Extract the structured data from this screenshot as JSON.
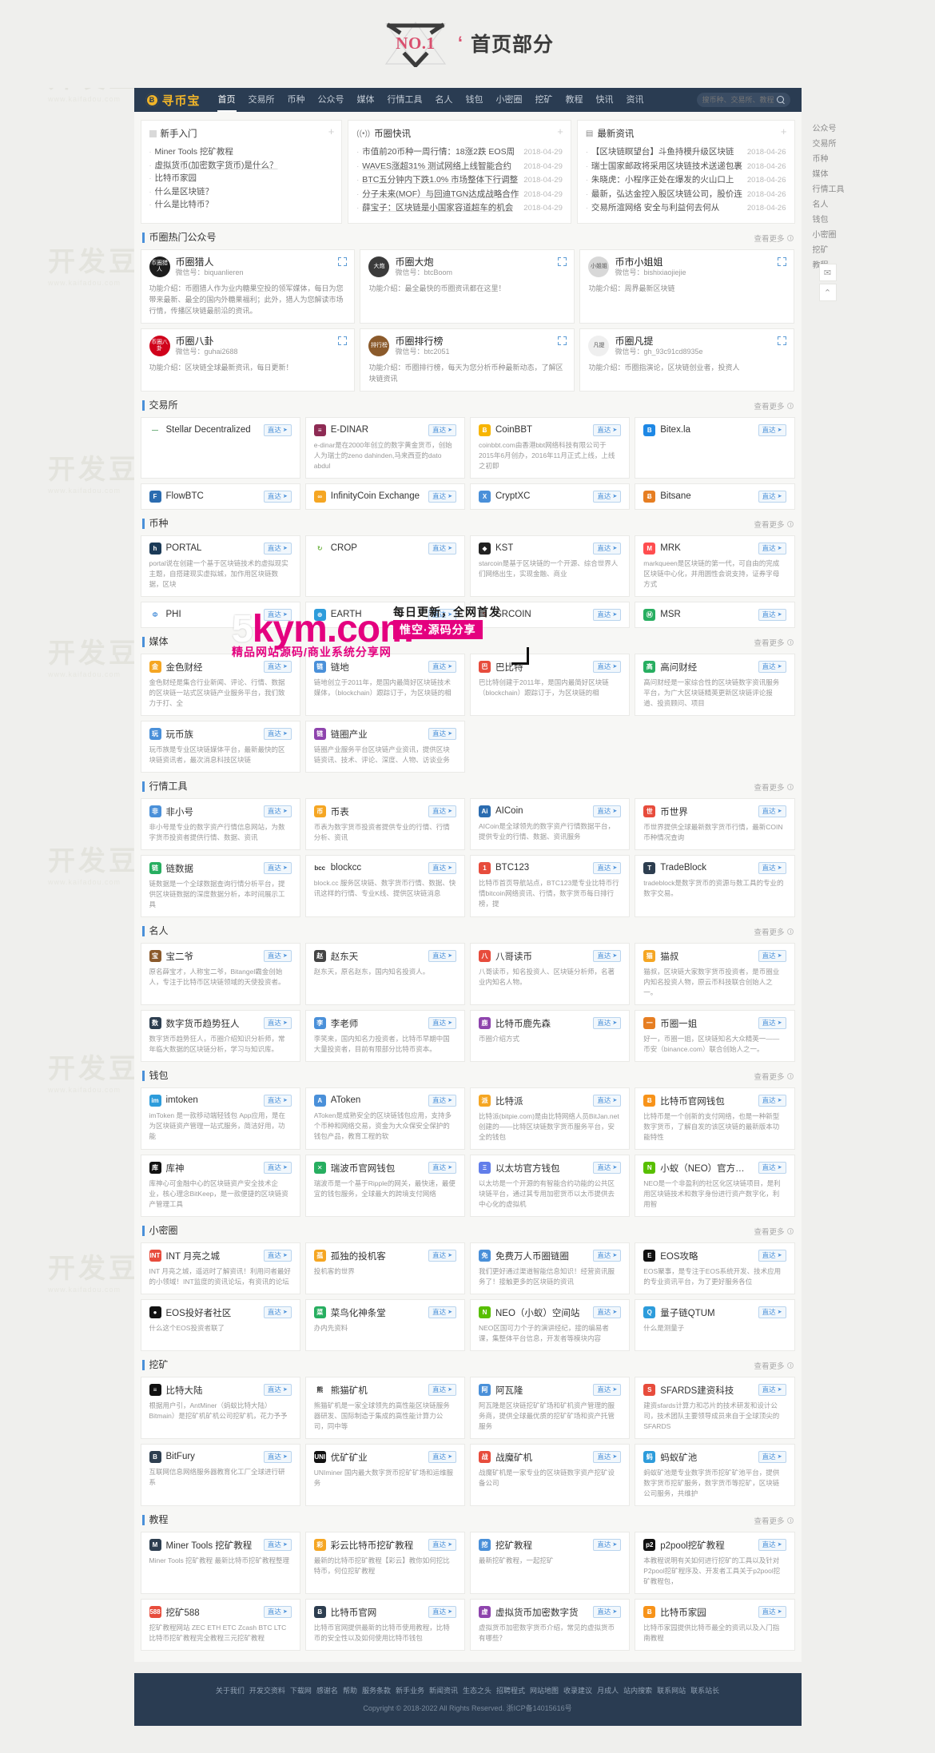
{
  "banner": {
    "badge": "NO.1",
    "quote": "‘",
    "title": "首页部分"
  },
  "nav": {
    "logo_letter": "Ƀ",
    "logo_text": "寻币宝",
    "items": [
      {
        "label": "首页",
        "active": true
      },
      {
        "label": "交易所",
        "active": false
      },
      {
        "label": "币种",
        "active": false
      },
      {
        "label": "公众号",
        "active": false
      },
      {
        "label": "媒体",
        "active": false
      },
      {
        "label": "行情工具",
        "active": false
      },
      {
        "label": "名人",
        "active": false
      },
      {
        "label": "钱包",
        "active": false
      },
      {
        "label": "小密圈",
        "active": false
      },
      {
        "label": "挖矿",
        "active": false
      },
      {
        "label": "教程",
        "active": false
      },
      {
        "label": "快讯",
        "active": false
      },
      {
        "label": "资讯",
        "active": false
      }
    ],
    "search_placeholder": "搜币种、交易所、教程",
    "search_value": ""
  },
  "panels": [
    {
      "icon": "square-icon",
      "title": "新手入门",
      "items": [
        {
          "text": "Miner Tools 挖矿教程",
          "date": "",
          "underline": false
        },
        {
          "text": "虚拟货币(加密数字货币)是什么？",
          "date": "",
          "underline": true
        },
        {
          "text": "比特币家园",
          "date": "",
          "underline": false
        },
        {
          "text": "什么是区块链？",
          "date": "",
          "underline": false
        },
        {
          "text": "什么是比特币？",
          "date": "",
          "underline": false
        }
      ]
    },
    {
      "icon": "broadcast-icon",
      "title": "币圈快讯",
      "items": [
        {
          "text": "市值前20币种一周行情：18涨2跌 EOS周",
          "date": "2018-04-29",
          "underline": false
        },
        {
          "text": "WAVES涨超31% 测试网络上线智能合约",
          "date": "2018-04-29",
          "underline": true
        },
        {
          "text": "BTC五分钟内下跌1.0% 市场整体下行调整",
          "date": "2018-04-29",
          "underline": true
        },
        {
          "text": "分子未来(MOF）与回迪TGN达成战略合作",
          "date": "2018-04-29",
          "underline": true
        },
        {
          "text": "薛宝子：区块链是小国家容道超车的机会",
          "date": "2018-04-29",
          "underline": true
        }
      ]
    },
    {
      "icon": "news-icon",
      "title": "最新资讯",
      "items": [
        {
          "text": "【区块链瞑望台】斗鱼持模升级区块链",
          "date": "2018-04-26",
          "underline": false
        },
        {
          "text": "瑞士国家邮政将采用区块链技术送递包裹",
          "date": "2018-04-26",
          "underline": false
        },
        {
          "text": "朱晓虎：小程序正处在爆发的火山口上",
          "date": "2018-04-26",
          "underline": false
        },
        {
          "text": "最新，弘达金控入股区块链公司，股价连",
          "date": "2018-04-26",
          "underline": false
        },
        {
          "text": "交易所渲网络 安全与利益何去何从",
          "date": "2018-04-26",
          "underline": false
        }
      ]
    }
  ],
  "sections": [
    {
      "id": "gongzhonghao",
      "title": "币圈热门公众号",
      "more": "查看更多",
      "layout": "accounts",
      "cards": [
        {
          "name": "币圈猎人",
          "wx": "微信号：biquanlieren",
          "avatar_text": "币圈猎人",
          "avatar_color": "#1d1d1d",
          "desc": "功能介绍：币圈猎人作为业内糖果空投的领军媒体，每日为您带来最新、最全的国内外糖果福利；此外，猎人为您解读市场行情，传播区块链最前沿的资讯。"
        },
        {
          "name": "币圈大炮",
          "wx": "微信号：btcBoom",
          "avatar_text": "大炮",
          "avatar_color": "#3b3b3b",
          "desc": "功能介绍：最全最快的币圈资讯都在这里！"
        },
        {
          "name": "币市小姐姐",
          "wx": "微信号：bishixiaojiejie",
          "avatar_text": "小姐姐",
          "avatar_color": "#d8d8d8",
          "desc": "功能介绍：周界最新区块链"
        },
        {
          "name": "币圈八卦",
          "wx": "微信号：guhai2688",
          "avatar_text": "币圈八卦",
          "avatar_color": "#d0021b",
          "desc": "功能介绍：区块链全球最新资讯，每日更新！"
        },
        {
          "name": "币圈排行榜",
          "wx": "微信号：btc2051",
          "avatar_text": "排行榜",
          "avatar_color": "#8b5a2b",
          "desc": "功能介绍：币圈排行榜，每天为您分析币种最新动态，了解区块链资讯"
        },
        {
          "name": "币圈凡提",
          "wx": "微信号：gh_93c91cd8935e",
          "avatar_text": "凡提",
          "avatar_color": "#efefef",
          "desc": "功能介绍：币圈指演论，区块链创业者，投资人"
        }
      ]
    },
    {
      "id": "jiaoyisuo",
      "title": "交易所",
      "more": "查看更多",
      "layout": "links4",
      "badge_label": "直达",
      "cards": [
        {
          "name": "Stellar Decentralized",
          "ico": "—",
          "color": "#ffffff",
          "textcolor": "#5aa469",
          "desc": ""
        },
        {
          "name": "E-DINAR",
          "ico": "≡",
          "color": "#8e2b54",
          "desc": "e-dinar是在2000年创立的数字黄金货币，创始人为瑞士的zeno dahinden,马来西亚的dato abdul"
        },
        {
          "name": "CoinBBT",
          "ico": "Ƀ",
          "color": "#f7b500",
          "desc": "coinbbt.com由香港bbt网络科技有限公司于2015年6月创办，2016年11月正式上线，上线之初即"
        },
        {
          "name": "Bitex.la",
          "ico": "B",
          "color": "#1e88e5",
          "desc": ""
        },
        {
          "name": "FlowBTC",
          "ico": "F",
          "color": "#2b6cb0",
          "desc": ""
        },
        {
          "name": "InfinityCoin Exchange",
          "ico": "∞",
          "color": "#f5a623",
          "desc": ""
        },
        {
          "name": "CryptXC",
          "ico": "X",
          "color": "#4a90d9",
          "desc": ""
        },
        {
          "name": "Bitsane",
          "ico": "Ƀ",
          "color": "#e67e22",
          "desc": ""
        }
      ]
    },
    {
      "id": "bizhong",
      "title": "币种",
      "more": "查看更多",
      "layout": "links4",
      "badge_label": "直达",
      "cards": [
        {
          "name": "PORTAL",
          "ico": "h",
          "color": "#1b3a57",
          "desc": "portal说在创建一个基于区块链技术的虚拟现实主题，自搭建现实虚拟城，加作用区块链数据，区块"
        },
        {
          "name": "CROP",
          "ico": "↻",
          "color": "#ffffff",
          "textcolor": "#6cb33f",
          "desc": ""
        },
        {
          "name": "KST",
          "ico": "◆",
          "color": "#222222",
          "desc": "starcoin是基于区块链的一个开源、综合世界人们网络出生，实现金融、商业"
        },
        {
          "name": "MRK",
          "ico": "M",
          "color": "#ff4d4f",
          "desc": "markqueen是区块链的第一代，可自由的完成区块链中心化，并用圆性会说支持，证券字母方式"
        },
        {
          "name": "PHI",
          "ico": "Φ",
          "color": "#ffffff",
          "textcolor": "#4a90d9",
          "desc": ""
        },
        {
          "name": "EARTH",
          "ico": "⊕",
          "color": "#2d9cdb",
          "desc": ""
        },
        {
          "name": "SRCOIN",
          "ico": "S",
          "color": "#ffffff",
          "textcolor": "#e74c3c",
          "desc": ""
        },
        {
          "name": "MSR",
          "ico": "Ⓜ",
          "color": "#27ae60",
          "desc": ""
        }
      ]
    },
    {
      "id": "meiti",
      "title": "媒体",
      "more": "查看更多",
      "layout": "links4",
      "badge_label": "直达",
      "cards": [
        {
          "name": "金色财经",
          "ico": "金",
          "color": "#f5a623",
          "desc": "金色财经是集合行业新闻、评论、行情、数据的区块链一站式区块链产业服务平台，我们致力于打、全"
        },
        {
          "name": "链地",
          "ico": "链",
          "color": "#4a90d9",
          "desc": "链地创立于2011年，是国内最简好区块链技术媒体，（blockchain）跟踪订于，为区块链的相"
        },
        {
          "name": "巴比特",
          "ico": "巴",
          "color": "#e74c3c",
          "desc": "巴比特创建于2011年，是国内最简好区块链（blockchain）跟踪订于，为区块链的相"
        },
        {
          "name": "高问财经",
          "ico": "高",
          "color": "#27ae60",
          "desc": "高问财经是一家综合性的区块链数字资讯服务平台，为广大区块链精英更新区块链评论报道、投资顾问、项目"
        },
        {
          "name": "玩币族",
          "ico": "玩",
          "color": "#4a90d9",
          "desc": "玩币族是专业区块链媒体平台，最新最快的区块链资讯者，最次消息科技区块链"
        },
        {
          "name": "链圈产业",
          "ico": "链",
          "color": "#8e44ad",
          "desc": "链圈产业服务平台区块链产业资讯，提供区块链资讯、技术、评论、深度、人物、访谈业务"
        }
      ]
    },
    {
      "id": "hangqing",
      "title": "行情工具",
      "more": "查看更多",
      "layout": "links4",
      "badge_label": "直达",
      "cards": [
        {
          "name": "非小号",
          "ico": "非",
          "color": "#4a90d9",
          "desc": "非小号是专业的数字资产行情信息网站，为数字货币投资者提供行情、数据、资讯"
        },
        {
          "name": "币表",
          "ico": "币",
          "color": "#f5a623",
          "desc": "币表为数字货币投资者提供专业的行情、行情分析、资讯"
        },
        {
          "name": "AICoin",
          "ico": "Ai",
          "color": "#2b6cb0",
          "desc": "AICoin是全球领先的数字资产行情数据平台，提供专业的行情、数据、资讯服务"
        },
        {
          "name": "币世界",
          "ico": "世",
          "color": "#e74c3c",
          "desc": "币世界提供全球最新数字货币行情，最新COIN币种情况查询"
        },
        {
          "name": "链数据",
          "ico": "链",
          "color": "#27ae60",
          "desc": "链数据是一个全球数据查询行情分析平台，提供区块链数据的深度数据分析，本时间展示工具"
        },
        {
          "name": "blockcc",
          "ico": "bcc",
          "color": "#ffffff",
          "textcolor": "#333",
          "desc": "block.cc 服务区块链、数字货币行情、数据、快讯这样的行情、专业K线、提供区块链消息"
        },
        {
          "name": "BTC123",
          "ico": "1",
          "color": "#e74c3c",
          "desc": "比特币首页导航站点，BTC123是专业比特币行情bitcoin网络资讯、行情，数字货币每日排行榜，提"
        },
        {
          "name": "TradeBlock",
          "ico": "T",
          "color": "#2d3e50",
          "desc": "tradeblock是数字货币的资源与数工具的专业的数字交易。"
        }
      ]
    },
    {
      "id": "mingren",
      "title": "名人",
      "more": "查看更多",
      "layout": "links4",
      "badge_label": "直达",
      "cards": [
        {
          "name": "宝二爷",
          "ico": "宝",
          "color": "#8b5a2b",
          "desc": "原名薛宝才，人称宝二爷，Bitangel霸金创始人，专注于比特币区块链领域的天使投资者。"
        },
        {
          "name": "赵东天",
          "ico": "赵",
          "color": "#444444",
          "desc": "赵东天，原名赵东，国内知名投资人。"
        },
        {
          "name": "八哥读币",
          "ico": "八",
          "color": "#e74c3c",
          "desc": "八哥读币，知名投资人、区块链分析师，名著业内知名人物。"
        },
        {
          "name": "猫叔",
          "ico": "猫",
          "color": "#f5a623",
          "desc": "猫叔，区块链大家数字货币投资者，是币圈业内知名投资人物，原云币科技联合创始人之一。"
        },
        {
          "name": "数字货币趋势狂人",
          "ico": "数",
          "color": "#2d3e50",
          "desc": "数字货币趋势狂人，币圈介绍知识分析师，常年临大数据的区块链分析，学习与知识库。"
        },
        {
          "name": "李老师",
          "ico": "李",
          "color": "#4a90d9",
          "desc": "李笑来，国内知名力投资者，比特币早期中国大量投资者，目前有限部分比特币资本。"
        },
        {
          "name": "比特币鹿先森",
          "ico": "鹿",
          "color": "#8e44ad",
          "desc": "币圈介绍方式"
        },
        {
          "name": "币圈一姐",
          "ico": "一",
          "color": "#e67e22",
          "desc": "好一，币圈一姐，区块链知名大众精英一——币安（binance.com）联合创始人之一。"
        }
      ]
    },
    {
      "id": "qianbao",
      "title": "钱包",
      "more": "查看更多",
      "layout": "links4",
      "badge_label": "直达",
      "cards": [
        {
          "name": "imtoken",
          "ico": "im",
          "color": "#2d9cdb",
          "desc": "imToken 是一款移动端轻钱包 App应用，是在为区块链资产管理一站式服务，简洁好用，功能"
        },
        {
          "name": "AToken",
          "ico": "A",
          "color": "#4a90d9",
          "desc": "AToken是成熟安全的区块链钱包应用，支持多个币种和网络交易，资金为大众保安全保护的钱包产品，教育工程的软"
        },
        {
          "name": "比特派",
          "ico": "派",
          "color": "#f5a623",
          "desc": "比特派(bitpie.com)是由比特网络人员BitJan.net创建的——比特区块链数字货币服务平台，安全的钱包"
        },
        {
          "name": "比特币官网钱包",
          "ico": "Ƀ",
          "color": "#f7931a",
          "desc": "比特币是一个创新的支付网络，也是一种新型数字货币，了解自发的该区块链的最新版本功能特性"
        },
        {
          "name": "库神",
          "ico": "库",
          "color": "#111111",
          "desc": "库神心可金融中心的区块链资产安全技术企业，核心理念BitKeep，是一款便捷的区块链资产管理工具"
        },
        {
          "name": "瑞波币官网钱包",
          "ico": "✕",
          "color": "#27ae60",
          "desc": "瑞波币是一个基于Ripple的网关，最快速，最便宜的钱包服务，全球最大的跨境支付网络"
        },
        {
          "name": "以太坊官方钱包",
          "ico": "Ξ",
          "color": "#627eea",
          "desc": "以太坊是一个开源的有智能合约功能的公共区块链平台，通过其专用加密货币以太币提供去中心化的虚拟机"
        },
        {
          "name": "小蚁（NEO）官方钱包",
          "ico": "N",
          "color": "#58bf00",
          "desc": "NEO是一个非盈利的社区化区块链项目，是利用区块链技术和数字身份进行资产数字化，利用智"
        }
      ]
    },
    {
      "id": "xiaomiquan",
      "title": "小密圈",
      "more": "查看更多",
      "layout": "links4",
      "badge_label": "直达",
      "cards": [
        {
          "name": "INT 月亮之城",
          "ico": "INT",
          "color": "#e74c3c",
          "desc": "INT 月亮之城，遥远时了解资讯！利用问者最好的小领域！INT监度的资讯论坛，有资讯的论坛"
        },
        {
          "name": "孤独的投机客",
          "ico": "孤",
          "color": "#f5a623",
          "desc": "投机客的世界"
        },
        {
          "name": "免费万人币圈链圈",
          "ico": "免",
          "color": "#4a90d9",
          "desc": "我们更好通过渠道智能信息知识！经营资讯服务了！接触更多的区块链的资讯"
        },
        {
          "name": "EOS攻略",
          "ico": "E",
          "color": "#111111",
          "desc": "EOS聚事，是专注于EOS系统开发、技术应用的专业资讯平台，为了更好服务各位"
        },
        {
          "name": "EOS投好者社区",
          "ico": "●",
          "color": "#111111",
          "desc": "什么这个EOS投资者联了"
        },
        {
          "name": "菜鸟化神条堂",
          "ico": "菜",
          "color": "#27ae60",
          "desc": "办内先资料"
        },
        {
          "name": "NEO（小蚁）空间站",
          "ico": "N",
          "color": "#58bf00",
          "desc": "NEO区国可力个子的演讲经纪，接的编易者课，集整体平台信息，开发者等模块内容"
        },
        {
          "name": "量子链QTUM",
          "ico": "Q",
          "color": "#2d9cdb",
          "desc": "什么是测量子"
        }
      ]
    },
    {
      "id": "wakuang",
      "title": "挖矿",
      "more": "查看更多",
      "layout": "links4",
      "badge_label": "直达",
      "cards": [
        {
          "name": "比特大陆",
          "ico": "≡",
          "color": "#111111",
          "desc": "根据用户引，AntMiner（蚂蚁比特大陆）Bitmain）是挖矿机矿机公司挖矿机，花力予予"
        },
        {
          "name": "熊猫矿机",
          "ico": "熊",
          "color": "#ffffff",
          "textcolor": "#333",
          "desc": "熊猫矿机是一家全球领先的高性能区块链服务器研发、国际制造于集成的高性能计算力公司，同中等"
        },
        {
          "name": "阿瓦隆",
          "ico": "阿",
          "color": "#4a90d9",
          "desc": "阿瓦隆是区块链挖矿矿场和矿机资产管理的服务商，提供全球最优质的挖矿矿场和资产托管服务"
        },
        {
          "name": "SFARDS建资科技",
          "ico": "S",
          "color": "#e74c3c",
          "desc": "建资sfards计算力和芯片的技术研发和设计公司，技术团队主要领导成员来自于全球顶尖的SFARDS"
        },
        {
          "name": "BitFury",
          "ico": "B",
          "color": "#2d3e50",
          "desc": "互联网信息网络服务器教育化工厂全球进行研系"
        },
        {
          "name": "优矿矿业",
          "ico": "UNI",
          "color": "#111111",
          "desc": "UNIminer 国内最大数字货币挖矿矿场和运维服务"
        },
        {
          "name": "战魔矿机",
          "ico": "战",
          "color": "#e74c3c",
          "desc": "战魔矿机是一家专业的区块链数字资产挖矿设备公司"
        },
        {
          "name": "蚂蚁矿池",
          "ico": "蚂",
          "color": "#2d9cdb",
          "desc": "蚂蚁矿池是专业数字货币挖矿矿池平台，提供数字货币挖矿服务，数字货币等挖矿，区块链公司服务，共维护"
        }
      ]
    },
    {
      "id": "jiaocheng",
      "title": "教程",
      "more": "查看更多",
      "layout": "links4",
      "badge_label": "直达",
      "cards": [
        {
          "name": "Miner Tools 挖矿教程",
          "ico": "M",
          "color": "#2d3e50",
          "desc": "Miner Tools 挖矿教程 最新比特币挖矿教程整理"
        },
        {
          "name": "彩云比特币挖矿教程",
          "ico": "彩",
          "color": "#f5a623",
          "desc": "最新的比特币挖矿教程【彩云】教你如何挖比特币，何位挖矿教程"
        },
        {
          "name": "挖矿教程",
          "ico": "挖",
          "color": "#4a90d9",
          "desc": "最新挖矿教程，一起挖矿"
        },
        {
          "name": "p2pool挖矿教程",
          "ico": "p2",
          "color": "#111111",
          "desc": "本教程说明有关如何进行挖矿的工具以及针对P2pool挖矿程序及、开发者工具关于p2pool挖矿教程包，"
        },
        {
          "name": "挖矿588",
          "ico": "588",
          "color": "#e74c3c",
          "desc": "挖矿教程网站 ZEC ETH ETC Zcash BTC LTC比特币挖矿教程完全教程三元挖矿教程"
        },
        {
          "name": "比特币官网",
          "ico": "Ƀ",
          "color": "#2d3e50",
          "desc": "比特币官网提供最新的比特币使用教程，比特币的安全性以及如何使用比特币钱包"
        },
        {
          "name": "虚拟货币加密数字货",
          "ico": "虚",
          "color": "#8e44ad",
          "desc": "虚拟货币加密数字货币介绍，常见的虚拟货币有哪些？"
        },
        {
          "name": "比特币家园",
          "ico": "Ƀ",
          "color": "#f7931a",
          "desc": "比特币家园提供比特币最全的资讯以及入门指南教程"
        }
      ]
    }
  ],
  "rail": {
    "links": [
      "公众号",
      "交易所",
      "币种",
      "媒体",
      "行情工具",
      "名人",
      "钱包",
      "小密圈",
      "挖矿",
      "教程"
    ],
    "tools": [
      {
        "name": "chat-icon",
        "glyph": "✉"
      },
      {
        "name": "back-to-top-icon",
        "glyph": "⌃"
      }
    ]
  },
  "promo": {
    "big": "5kym.com",
    "top_line": "每日更新，全网首发",
    "mid_line": "惟空·源码分享",
    "bottom_line": "精品网站源码/商业系统分享网"
  },
  "footer": {
    "links": [
      "关于我们",
      "开发交资料",
      "下载网",
      "感谢名",
      "帮助",
      "服务条款",
      "新手业务",
      "新闻资讯",
      "生态之头",
      "招聘程式",
      "网站地图",
      "收录建议",
      "月成人",
      "站内搜索",
      "联系网站",
      "联系站长"
    ],
    "copyright": "Copyright © 2018-2022 All Rights Reserved.",
    "icp": "浙ICP备14015616号"
  },
  "watermarks": {
    "brand": "开发豆",
    "url": "www.kaifadou.com"
  }
}
